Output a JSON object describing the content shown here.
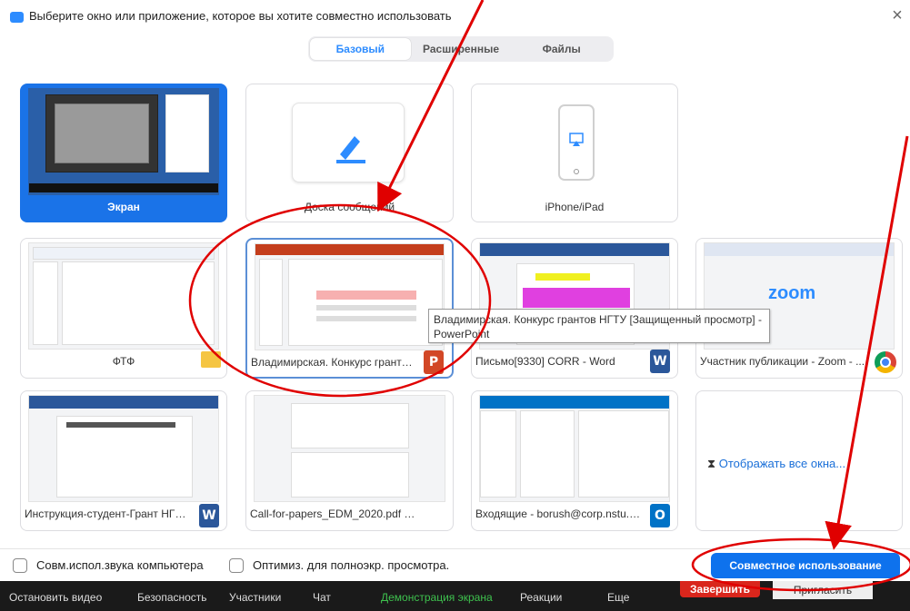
{
  "window": {
    "title": "Выберите окно или приложение, которое вы хотите совместно использовать"
  },
  "tabs": [
    {
      "label": "Базовый",
      "active": true
    },
    {
      "label": "Расширенные",
      "active": false
    },
    {
      "label": "Файлы",
      "active": false
    }
  ],
  "items": [
    {
      "label": "Экран",
      "selected": true
    },
    {
      "label": "Доска сообщений"
    },
    {
      "label": "iPhone/iPad"
    },
    {
      "label": "ФТФ",
      "icon": "folder-icon"
    },
    {
      "label": "Владимирская. Конкурс грантов...",
      "icon": "powerpoint-icon",
      "hovered": true
    },
    {
      "label": "Письмо[9330] CORR - Word",
      "icon": "word-icon"
    },
    {
      "label": "Участник публикации - Zoom - ...",
      "icon": "chrome-icon",
      "thumb_text": "zoom"
    },
    {
      "label": "Инструкция-студент-Грант НГТУ ...",
      "icon": "word-icon"
    },
    {
      "label": "Call-for-papers_EDM_2020.pdf - ...",
      "icon": "pdf-icon"
    },
    {
      "label": "Входящие - borush@corp.nstu.ru...",
      "icon": "outlook-icon"
    },
    {
      "label": "Отображать все окна..."
    }
  ],
  "tooltip": "Владимирская. Конкурс грантов НГТУ [Защищенный просмотр] - PowerPoint",
  "options": [
    {
      "label": "Совм.испол.звука компьютера",
      "checked": false
    },
    {
      "label": "Оптимиз. для полноэкр. просмотра.",
      "checked": false
    }
  ],
  "share_button": "Совместное использование",
  "taskbar": {
    "items": [
      "Остановить видео",
      "Безопасность",
      "Участники",
      "Чат",
      "Демонстрация экрана",
      "Реакции",
      "Еще"
    ],
    "end_label": "Завершить",
    "invite_label": "Пригласить"
  },
  "icons": {
    "word": "W",
    "ppt": "P",
    "outlook": "O"
  },
  "colors": {
    "accent": "#0e72ed",
    "selected": "#1a73e8",
    "annotation": "#e00000"
  }
}
